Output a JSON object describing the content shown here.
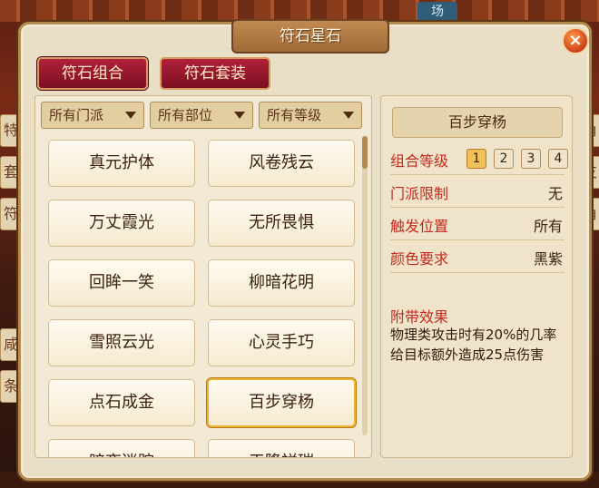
{
  "background": {
    "top_tag": "场",
    "left_chars": [
      "特",
      "套",
      "符",
      "",
      "咸",
      "条",
      "",
      "",
      ""
    ],
    "right_chars": [
      "角",
      "支",
      "角"
    ]
  },
  "window": {
    "title": "符石星石",
    "close_icon": "×"
  },
  "tabs": [
    {
      "label": "符石组合"
    },
    {
      "label": "符石套装"
    }
  ],
  "filters": [
    {
      "label": "所有门派"
    },
    {
      "label": "所有部位"
    },
    {
      "label": "所有等级"
    }
  ],
  "stones": [
    {
      "name": "真元护体"
    },
    {
      "name": "风卷残云"
    },
    {
      "name": "万丈霞光"
    },
    {
      "name": "无所畏惧"
    },
    {
      "name": "回眸一笑"
    },
    {
      "name": "柳暗花明"
    },
    {
      "name": "雪照云光"
    },
    {
      "name": "心灵手巧"
    },
    {
      "name": "点石成金"
    },
    {
      "name": "百步穿杨"
    },
    {
      "name": "暗夜迷踪"
    },
    {
      "name": "天降祥瑞"
    }
  ],
  "detail": {
    "title": "百步穿杨",
    "combo_level_label": "组合等级",
    "levels": [
      "1",
      "2",
      "3",
      "4"
    ],
    "active_level": "1",
    "sect_label": "门派限制",
    "sect_value": "无",
    "trigger_label": "触发位置",
    "trigger_value": "所有",
    "color_label": "颜色要求",
    "color_value": "黑紫",
    "effect_label": "附带效果",
    "effect_text": "物理类攻击时有20%的几率给目标额外造成25点伤害"
  }
}
